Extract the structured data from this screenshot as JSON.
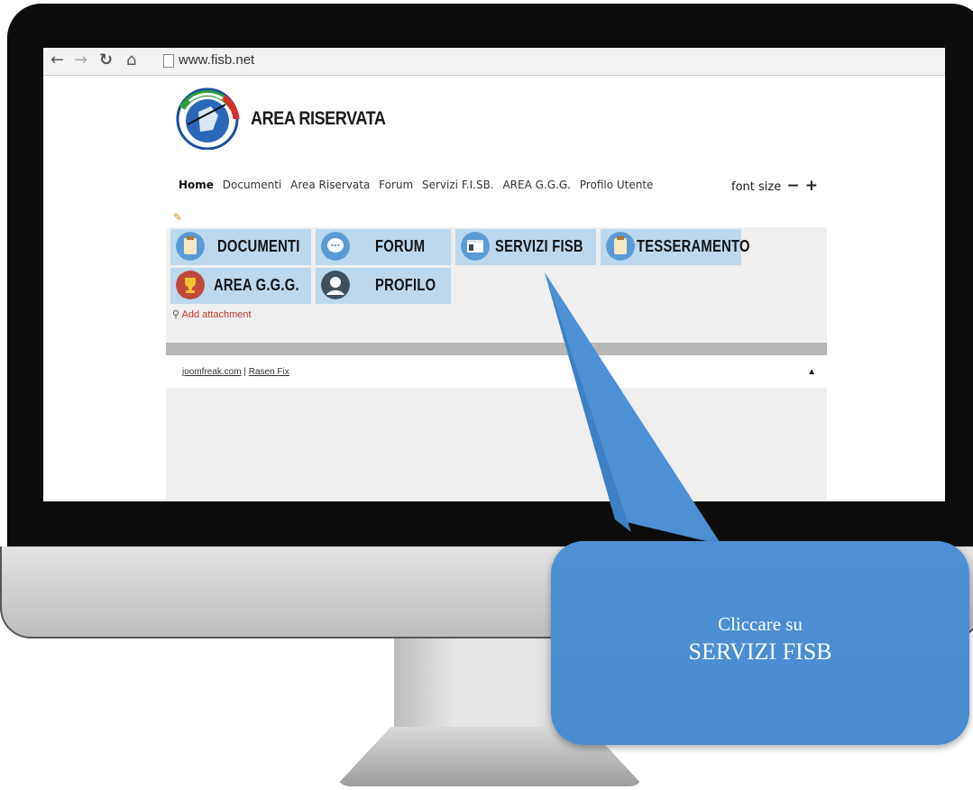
{
  "browser": {
    "url": "www.fisb.net",
    "back_icon": "arrow-left-icon",
    "forward_icon": "arrow-right-icon",
    "reload_icon": "reload-icon",
    "home_icon": "home-icon"
  },
  "header": {
    "title": "AREA RISERVATA"
  },
  "menu": {
    "items": [
      "Home",
      "Documenti",
      "Area Riservata",
      "Forum",
      "Servizi F.I.SB.",
      "AREA G.G.G.",
      "Profilo Utente"
    ],
    "active": "Home",
    "font_size_label": "font size",
    "decrease": "−",
    "increase": "+"
  },
  "tiles": [
    {
      "label": "DOCUMENTI",
      "icon": "clipboard-icon"
    },
    {
      "label": "FORUM",
      "icon": "chat-bubble-icon"
    },
    {
      "label": "SERVIZI FISB",
      "icon": "browser-window-icon"
    },
    {
      "label": "TESSERAMENTO",
      "icon": "clipboard-icon"
    },
    {
      "label": "AREA G.G.G.",
      "icon": "trophy-icon"
    },
    {
      "label": "PROFILO",
      "icon": "user-icon"
    }
  ],
  "attachment": {
    "label": "Add attachment"
  },
  "footer": {
    "link1": "joomfreak.com",
    "separator": "|",
    "link2": "Rasen Fix",
    "up_arrow": "▲"
  },
  "callout": {
    "line1": "Cliccare su",
    "line2": "SERVIZI FISB"
  },
  "colors": {
    "tile_bg": "#bcd8ee",
    "callout_bg": "#4a8bd0",
    "monitor_bezel": "#0c0c0c"
  }
}
